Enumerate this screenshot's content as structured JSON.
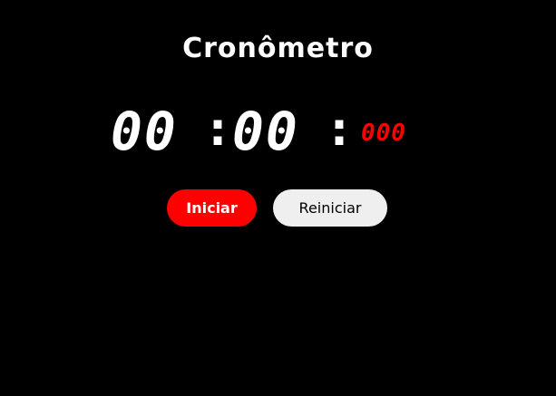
{
  "app": {
    "title": "Cronômetro"
  },
  "timer": {
    "minutes": "00",
    "separator_1": ":",
    "seconds": "00",
    "separator_2": ":",
    "milliseconds": "000"
  },
  "controls": {
    "start_label": "Iniciar",
    "reset_label": "Reiniciar"
  },
  "colors": {
    "background": "#000000",
    "text": "#ffffff",
    "accent": "#ff0000",
    "reset_button": "#efefef"
  }
}
